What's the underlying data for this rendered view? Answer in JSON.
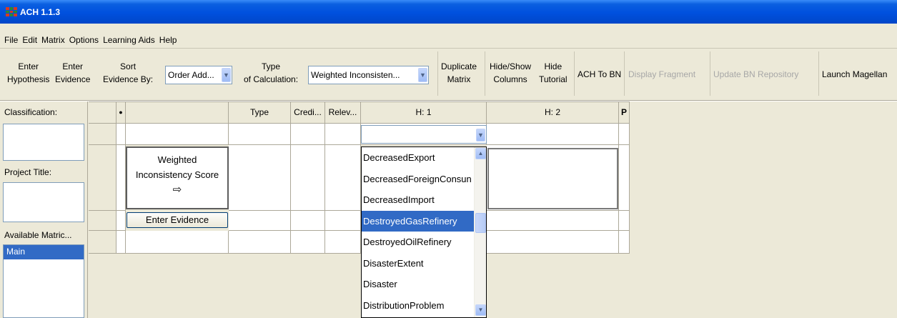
{
  "window": {
    "title": "ACH 1.1.3"
  },
  "menu": [
    {
      "label": "File"
    },
    {
      "label": "Edit"
    },
    {
      "label": "Matrix"
    },
    {
      "label": "Options"
    },
    {
      "label": "Learning Aids"
    },
    {
      "label": "Help"
    }
  ],
  "toolbar": {
    "enter_hypothesis": [
      "Enter",
      "Hypothesis"
    ],
    "enter_evidence": [
      "Enter",
      "Evidence"
    ],
    "sort_evidence_by": [
      "Sort",
      "Evidence By:"
    ],
    "sort_value": "Order Add...",
    "type_of_calc": [
      "Type",
      "of Calculation:"
    ],
    "calc_value": "Weighted Inconsisten...",
    "duplicate_matrix": [
      "Duplicate",
      "Matrix"
    ],
    "hide_show_columns": [
      "Hide/Show",
      "Columns"
    ],
    "hide_tutorial": [
      "Hide",
      "Tutorial"
    ],
    "ach_to_bn": "ACH To BN",
    "display_fragment": "Display Fragment",
    "update_bn_repository": "Update BN Repository",
    "launch_magellan": "Launch Magellan"
  },
  "left_panel": {
    "classification_label": "Classification:",
    "project_title_label": "Project Title:",
    "available_matrices_label": "Available Matric...",
    "matrices": [
      "Main"
    ]
  },
  "grid": {
    "headers": {
      "type": "Type",
      "credibility": "Credi...",
      "relevance": "Relev...",
      "h1": "H: 1",
      "h2": "H: 2"
    },
    "score_label": [
      "Weighted",
      "Inconsistency Score"
    ],
    "enter_evidence_button": "Enter Evidence"
  },
  "dropdown": {
    "items": [
      "DecreasedExport",
      "DecreasedForeignConsun",
      "DecreasedImport",
      "DestroyedGasRefinery",
      "DestroyedOilRefinery",
      "DisasterExtent",
      "Disaster",
      "DistributionProblem"
    ],
    "selected_index": 3
  },
  "colors": {
    "selection": "#316ac5",
    "titlebar": "#0050de",
    "disabled_text": "#a7a7a7"
  }
}
